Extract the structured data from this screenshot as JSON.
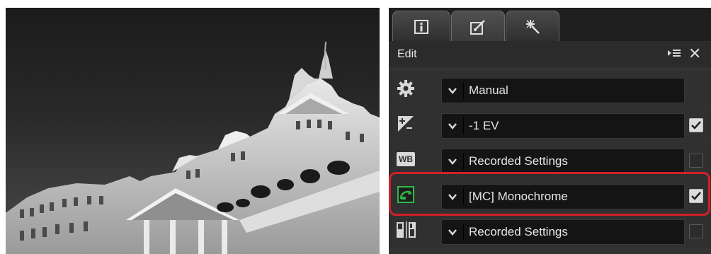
{
  "panel": {
    "tabs": [
      {
        "icon": "info-icon",
        "active": false
      },
      {
        "icon": "edit-brush-icon",
        "active": true
      },
      {
        "icon": "sparkle-wand-icon",
        "active": false
      }
    ],
    "header_title": "Edit",
    "header_icons": [
      "panel-menu-icon",
      "close-icon"
    ]
  },
  "rows": [
    {
      "icon": "gear-icon",
      "value": "Manual",
      "checkbox": false
    },
    {
      "icon": "exposure-compensation-icon",
      "value": "-1 EV",
      "checkbox": true,
      "checked": true
    },
    {
      "icon": "white-balance-icon",
      "icon_text": "WB",
      "value": "Recorded Settings",
      "checkbox": true,
      "checked": false
    },
    {
      "icon": "picture-control-icon",
      "value": "[MC] Monochrome",
      "checkbox": true,
      "checked": true,
      "highlighted": true
    },
    {
      "icon": "active-d-lighting-icon",
      "value": "Recorded Settings",
      "checkbox": true,
      "checked": false
    }
  ],
  "colors": {
    "panel_bg": "#333333",
    "highlight": "#d2202a",
    "picture_control_accent": "#2fb84a"
  }
}
